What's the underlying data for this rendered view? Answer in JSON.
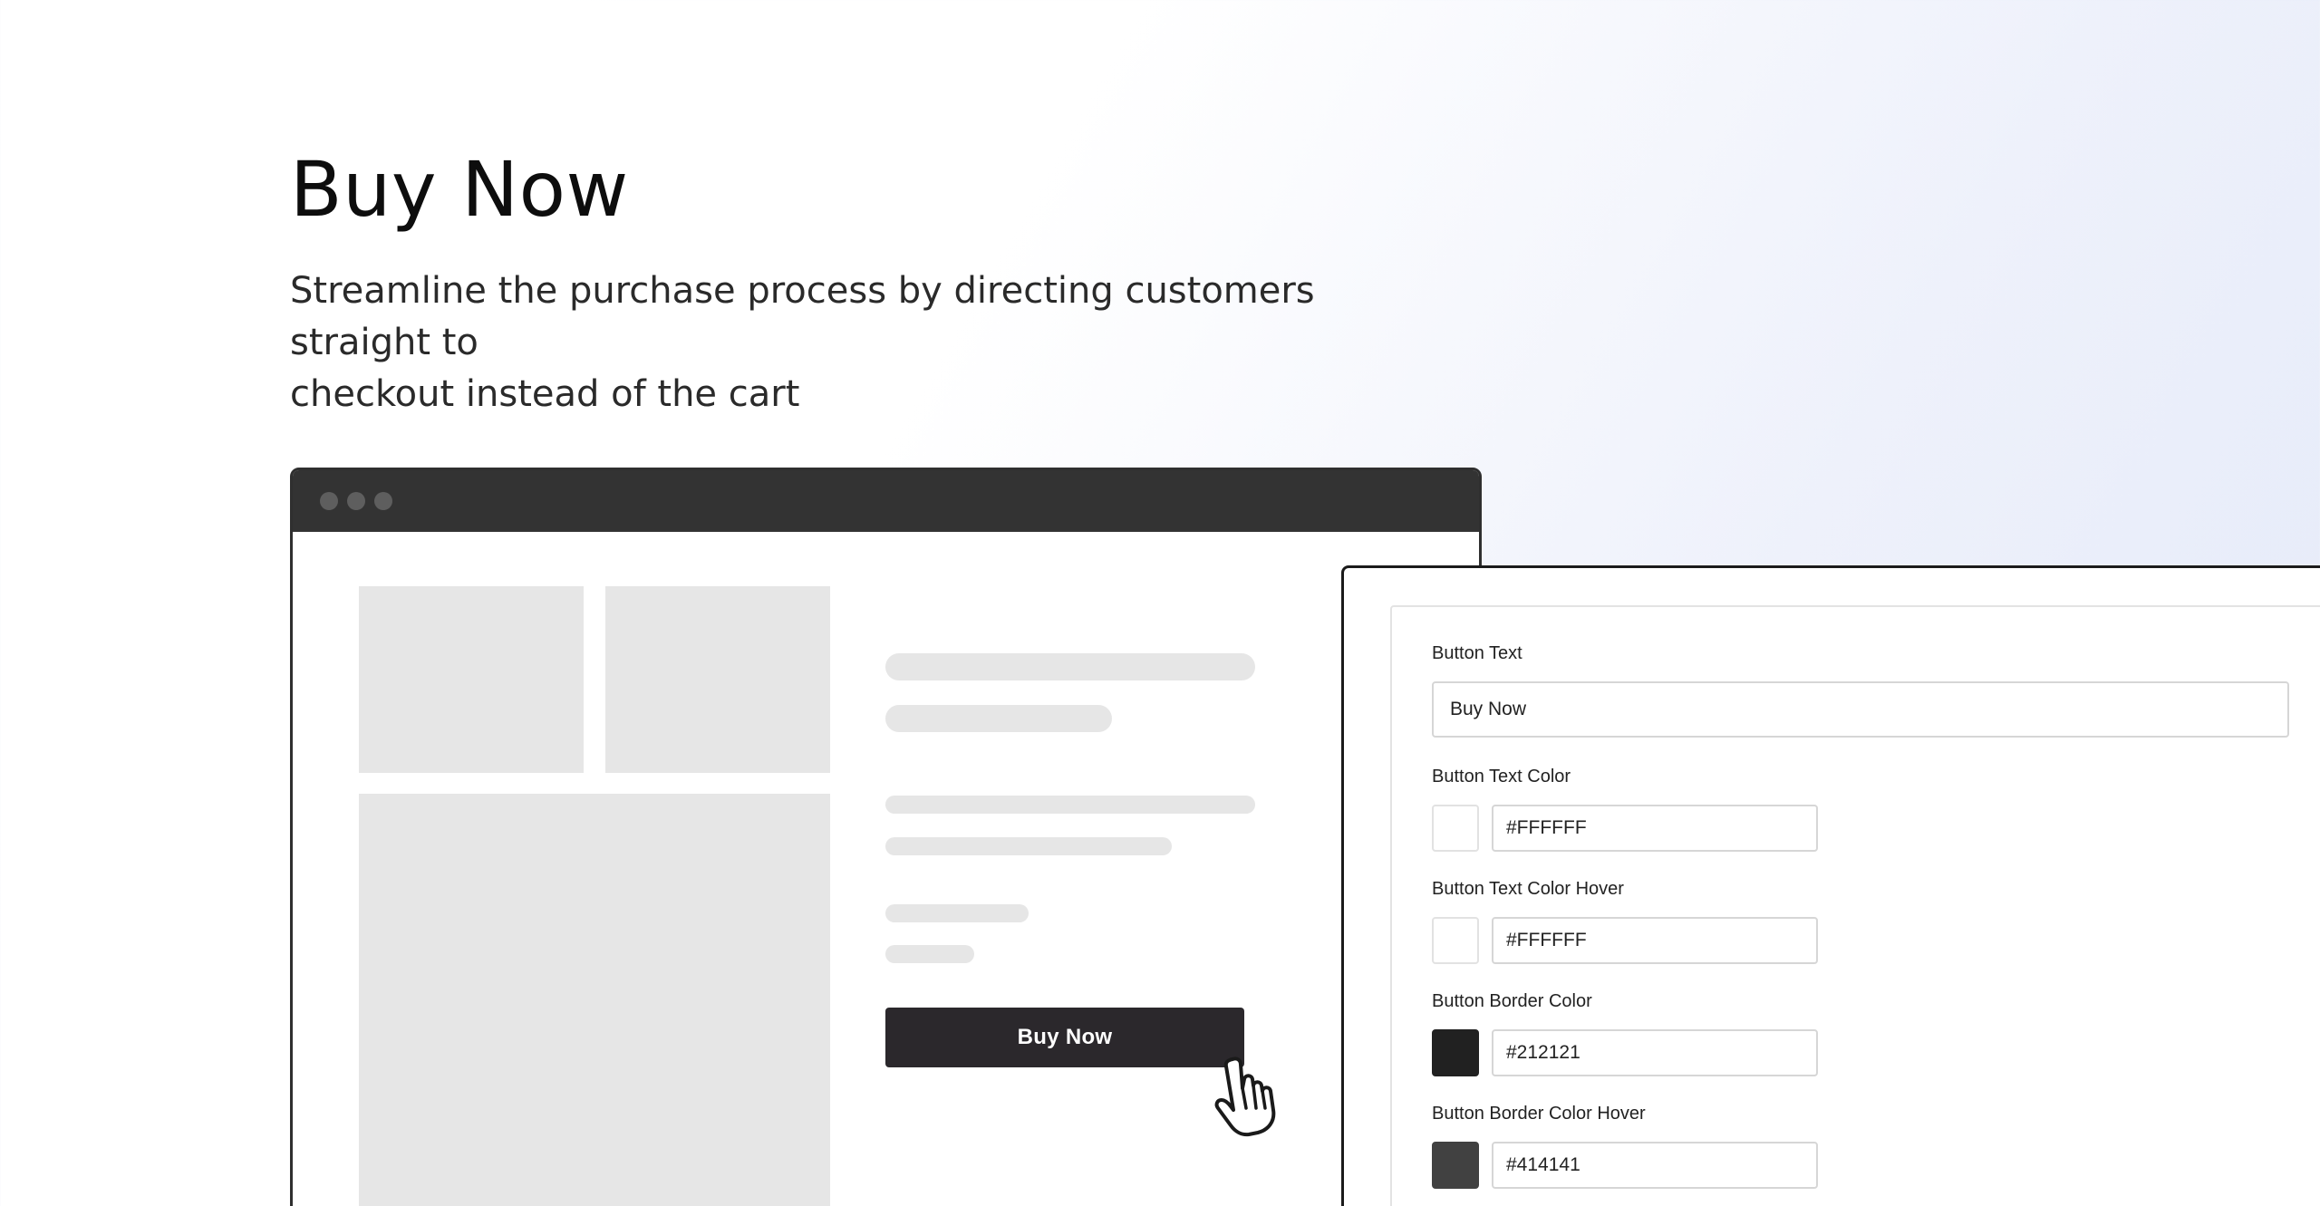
{
  "hero": {
    "title": "Buy Now",
    "subtitle_line1": "Streamline the purchase process by directing customers straight to",
    "subtitle_line2": "checkout instead of the cart"
  },
  "preview": {
    "buy_button_label": "Buy Now"
  },
  "settings": {
    "button_text": {
      "label": "Button Text",
      "value": "Buy Now"
    },
    "colors": [
      {
        "label": "Button Text Color",
        "value": "#FFFFFF",
        "swatch": "#FFFFFF"
      },
      {
        "label": "Button Text Color Hover",
        "value": "#FFFFFF",
        "swatch": "#FFFFFF"
      },
      {
        "label": "Button Border Color",
        "value": "#212121",
        "swatch": "#212121"
      },
      {
        "label": "Button Border Color Hover",
        "value": "#414141",
        "swatch": "#414141"
      }
    ]
  },
  "icons": {
    "cursor": "hand-pointer-icon"
  }
}
